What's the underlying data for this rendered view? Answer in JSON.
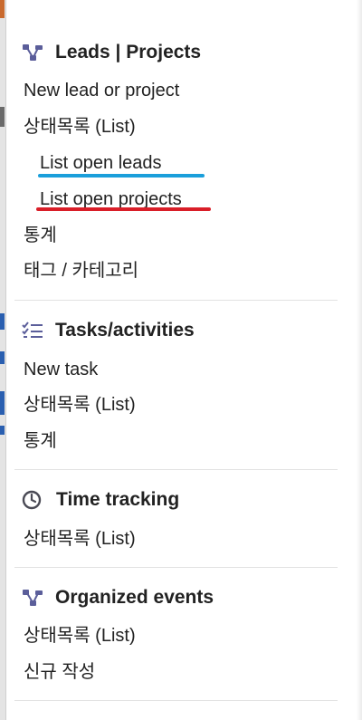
{
  "sections": [
    {
      "title": "Leads | Projects",
      "icon": "hierarchy-icon",
      "items": [
        {
          "label": "New lead or project"
        },
        {
          "label": "상태목록 (List)"
        },
        {
          "label": "List open leads",
          "highlight_color": "#1a9fdb"
        },
        {
          "label": "List open projects",
          "highlight_color": "#d91e28"
        },
        {
          "label": "통계"
        },
        {
          "label": "태그 / 카테고리"
        }
      ]
    },
    {
      "title": "Tasks/activities",
      "icon": "task-list-icon",
      "items": [
        {
          "label": "New task"
        },
        {
          "label": "상태목록 (List)"
        },
        {
          "label": "통계"
        }
      ]
    },
    {
      "title": "Time tracking",
      "icon": "clock-icon",
      "items": [
        {
          "label": "상태목록 (List)"
        }
      ]
    },
    {
      "title": "Organized events",
      "icon": "hierarchy-icon",
      "items": [
        {
          "label": "상태목록 (List)"
        },
        {
          "label": "신규 작성"
        }
      ]
    }
  ],
  "colors": {
    "icon": "#5b5e9a",
    "text": "#222222",
    "divider": "#e2e2e2"
  }
}
